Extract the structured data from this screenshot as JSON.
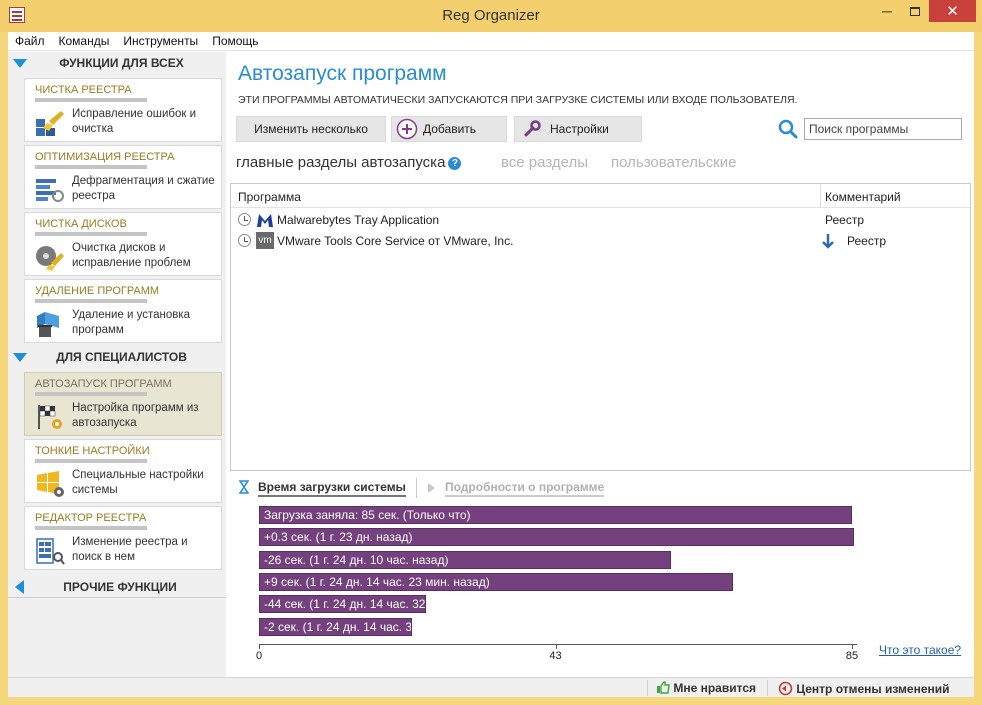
{
  "window": {
    "title": "Reg Organizer",
    "min_glyph": "─",
    "close_glyph": "✕"
  },
  "menu": [
    "Файл",
    "Команды",
    "Инструменты",
    "Помощь"
  ],
  "sidebar": {
    "group_all": "ФУНКЦИИ ДЛЯ ВСЕХ",
    "group_pro": "ДЛЯ СПЕЦИАЛИСТОВ",
    "group_other": "ПРОЧИЕ ФУНКЦИИ",
    "cards": [
      {
        "title": "ЧИСТКА РЕЕСТРА",
        "desc": "Исправление ошибок и очистка",
        "icon": "registry-clean-icon"
      },
      {
        "title": "ОПТИМИЗАЦИЯ РЕЕСТРА",
        "desc": "Дефрагментация и сжатие реестра",
        "icon": "registry-optimize-icon"
      },
      {
        "title": "ЧИСТКА ДИСКОВ",
        "desc": "Очистка дисков и исправление проблем",
        "icon": "disk-clean-icon"
      },
      {
        "title": "УДАЛЕНИЕ ПРОГРАММ",
        "desc": "Удаление и установка программ",
        "icon": "uninstall-icon"
      },
      {
        "title": "АВТОЗАПУСК ПРОГРАММ",
        "desc": "Настройка программ из автозапуска",
        "icon": "startup-icon"
      },
      {
        "title": "ТОНКИЕ НАСТРОЙКИ",
        "desc": "Специальные настройки системы",
        "icon": "tweaks-icon"
      },
      {
        "title": "РЕДАКТОР РЕЕСТРА",
        "desc": "Изменение реестра и поиск в нем",
        "icon": "registry-editor-icon"
      }
    ]
  },
  "main": {
    "title": "Автозапуск программ",
    "subtitle": "ЭТИ ПРОГРАММЫ АВТОМАТИЧЕСКИ ЗАПУСКАЮТСЯ ПРИ ЗАГРУЗКЕ СИСТЕМЫ ИЛИ ВХОДЕ ПОЛЬЗОВАТЕЛЯ.",
    "toolbar": {
      "edit_multiple": "Изменить несколько",
      "add": "Добавить",
      "settings": "Настройки",
      "search_placeholder": "Поиск программы"
    },
    "section_tabs": {
      "main": "главные разделы автозапуска",
      "help_glyph": "?",
      "all": "все разделы",
      "user": "пользовательские"
    },
    "list": {
      "columns": [
        "Программа",
        "Комментарий"
      ],
      "rows": [
        {
          "name": "Malwarebytes Tray Application",
          "comment": "Реестр",
          "icon": "malwarebytes-icon"
        },
        {
          "name": "VMware Tools Core Service от VMware, Inc.",
          "comment": "Реестр",
          "icon": "vmware-icon",
          "vm_glyph": "vm"
        }
      ]
    },
    "bottom_tabs": {
      "boot_time": "Время загрузки системы",
      "details": "Подробности о программе"
    },
    "boot_chart": {
      "type": "bar",
      "orientation": "horizontal",
      "xlim": [
        0,
        85
      ],
      "ticks": [
        "0",
        "43",
        "85"
      ],
      "bars": [
        {
          "label": "Загрузка заняла: 85 сек. (Только что)",
          "value": 85
        },
        {
          "label": "+0.3 сек. (1 г. 23 дн. назад)",
          "value": 85.3
        },
        {
          "label": "-26 сек. (1 г. 24 дн. 10 час. назад)",
          "value": 59
        },
        {
          "label": "+9 сек. (1 г. 24 дн. 14 час. 23 мин. назад)",
          "value": 68
        },
        {
          "label": "-44 сек. (1 г. 24 дн. 14 час. 32 ...",
          "value": 24
        },
        {
          "label": "-2 сек. (1 г. 24 дн. 14 час. 3...",
          "value": 22
        }
      ]
    },
    "help_link": "Что это такое?"
  },
  "status": {
    "like": "Мне нравится",
    "undo_center": "Центр отмены изменений"
  }
}
